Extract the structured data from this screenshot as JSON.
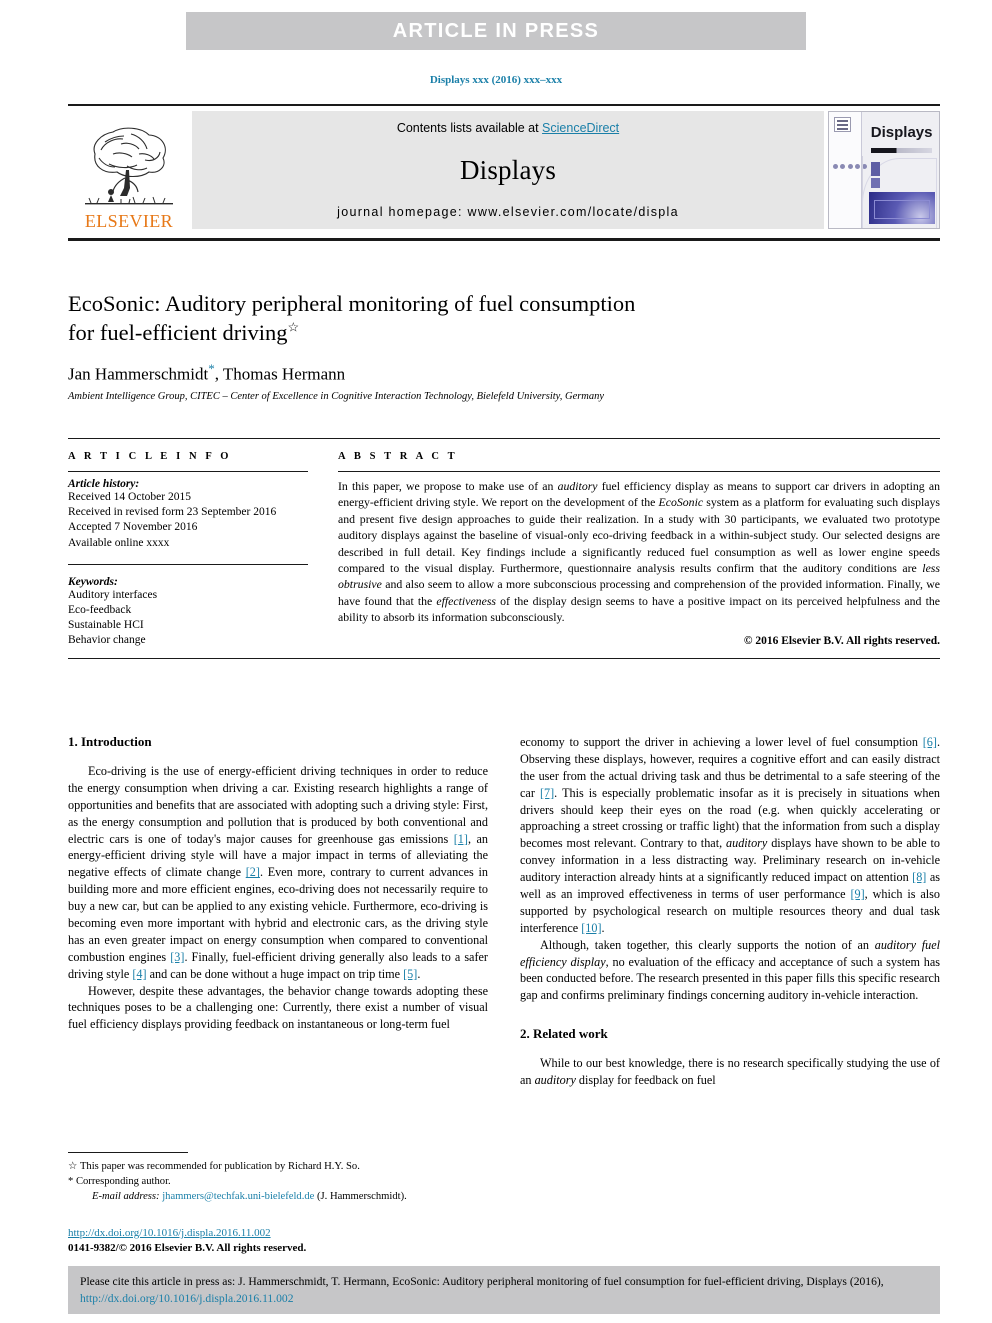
{
  "banner": {
    "label": "ARTICLE  IN  PRESS"
  },
  "volume_line": "Displays xxx (2016) xxx–xxx",
  "masthead": {
    "contents_prefix": "Contents lists available at ",
    "sciencedirect": "ScienceDirect",
    "journal_title": "Displays",
    "homepage": "journal homepage: www.elsevier.com/locate/displa",
    "publisher_word": "ELSEVIER",
    "cover_title": "Displays"
  },
  "article": {
    "title_line1": "EcoSonic: Auditory peripheral monitoring of fuel consumption",
    "title_line2": "for fuel-efficient driving",
    "title_star": "☆",
    "authors_a": "Jan Hammerschmidt",
    "authors_star": "*",
    "authors_b": ", Thomas Hermann",
    "affiliation": "Ambient Intelligence Group, CITEC – Center of Excellence in Cognitive Interaction Technology, Bielefeld University, Germany"
  },
  "info": {
    "heading": "A R T I C L E   I N F O",
    "history_label": "Article history:",
    "history": [
      "Received 14 October 2015",
      "Received in revised form 23 September 2016",
      "Accepted 7 November 2016",
      "Available online xxxx"
    ],
    "keywords_label": "Keywords:",
    "keywords": [
      "Auditory interfaces",
      "Eco-feedback",
      "Sustainable HCI",
      "Behavior change"
    ]
  },
  "abstract": {
    "heading": "A B S T R A C T",
    "p1_a": "In this paper, we propose to make use of an ",
    "p1_i1": "auditory",
    "p1_b": " fuel efficiency display as means to support car drivers in adopting an energy-efficient driving style. We report on the development of the ",
    "p1_i2": "EcoSonic",
    "p1_c": " system as a platform for evaluating such displays and present five design approaches to guide their realization. In a study with 30 participants, we evaluated two prototype auditory displays against the baseline of visual-only eco-driving feedback in a within-subject study. Our selected designs are described in full detail. Key findings include a significantly reduced fuel consumption as well as lower engine speeds compared to the visual display. Furthermore, questionnaire analysis results confirm that the auditory conditions are ",
    "p1_i3": "less obtrusive",
    "p1_d": " and also seem to allow a more subconscious processing and comprehension of the provided information. Finally, we have found that the ",
    "p1_i4": "effectiveness",
    "p1_e": " of the display design seems to have a positive impact on its perceived helpfulness and the ability to absorb its information subconsciously.",
    "copyright": "© 2016 Elsevier B.V. All rights reserved."
  },
  "body": {
    "sec1_heading": "1. Introduction",
    "sec1_p1_a": "Eco-driving is the use of energy-efficient driving techniques in order to reduce the energy consumption when driving a car. Existing research highlights a range of opportunities and benefits that are associated with adopting such a driving style: First, as the energy consumption and pollution that is produced by both conventional and electric cars is one of today's major causes for greenhouse gas emissions ",
    "sec1_p1_r1": "[1]",
    "sec1_p1_b": ", an energy-efficient driving style will have a major impact in terms of alleviating the negative effects of climate change ",
    "sec1_p1_r2": "[2]",
    "sec1_p1_c": ". Even more, contrary to current advances in building more and more efficient engines, eco-driving does not necessarily require to buy a new car, but can be applied to any existing vehicle. Furthermore, eco-driving is becoming even more important with hybrid and electronic cars, as the driving style has an even greater impact on energy consumption when compared to conventional combustion engines ",
    "sec1_p1_r3": "[3]",
    "sec1_p1_d": ". Finally, fuel-efficient driving generally also leads to a safer driving style ",
    "sec1_p1_r4": "[4]",
    "sec1_p1_e": " and can be done without a huge impact on trip time ",
    "sec1_p1_r5": "[5]",
    "sec1_p1_f": ".",
    "sec1_p2": "However, despite these advantages, the behavior change towards adopting these techniques poses to be a challenging one: Currently, there exist a number of visual fuel efficiency displays providing feedback on instantaneous or long-term fuel",
    "rcol_p1_a": "economy to support the driver in achieving a lower level of fuel consumption ",
    "rcol_p1_r6": "[6]",
    "rcol_p1_b": ". Observing these displays, however, requires a cognitive effort and can easily distract the user from the actual driving task and thus be detrimental to a safe steering of the car ",
    "rcol_p1_r7": "[7]",
    "rcol_p1_c": ". This is especially problematic insofar as it is precisely in situations when drivers should keep their eyes on the road (e.g. when quickly accelerating or approaching a street crossing or traffic light) that the information from such a display becomes most relevant. Contrary to that, ",
    "rcol_p1_i1": "auditory",
    "rcol_p1_d": " displays have shown to be able to convey information in a less distracting way. Preliminary research on in-vehicle auditory interaction already hints at a significantly reduced impact on attention ",
    "rcol_p1_r8": "[8]",
    "rcol_p1_e": " as well as an improved effectiveness in terms of user performance ",
    "rcol_p1_r9": "[9]",
    "rcol_p1_f": ", which is also supported by psychological research on multiple resources theory and dual task interference ",
    "rcol_p1_r10": "[10]",
    "rcol_p1_g": ".",
    "rcol_p2_a": "Although, taken together, this clearly supports the notion of an ",
    "rcol_p2_i1": "auditory fuel efficiency display",
    "rcol_p2_b": ", no evaluation of the efficacy and acceptance of such a system has been conducted before. The research presented in this paper fills this specific research gap and confirms preliminary findings concerning auditory in-vehicle interaction.",
    "sec2_heading": "2. Related work",
    "sec2_p1_a": "While to our best knowledge, there is no research specifically studying the use of an ",
    "sec2_p1_i1": "auditory",
    "sec2_p1_b": " display for feedback on fuel"
  },
  "footnotes": {
    "fn1_mark": "☆",
    "fn1_text": " This paper was recommended for publication by Richard H.Y. So.",
    "fn2_mark": "*",
    "fn2_text": " Corresponding author.",
    "email_label": "E-mail address:",
    "email": "jhammers@techfak.uni-bielefeld.de",
    "email_suffix": " (J. Hammerschmidt).",
    "doi": "http://dx.doi.org/10.1016/j.displa.2016.11.002",
    "issn": "0141-9382/© 2016 Elsevier B.V. All rights reserved."
  },
  "cite_bar": {
    "text_a": "Please cite this article in press as: J. Hammerschmidt, T. Hermann, EcoSonic: Auditory peripheral monitoring of fuel consumption for fuel-efficient driving, Displays (2016), ",
    "link": "http://dx.doi.org/10.1016/j.displa.2016.11.002"
  },
  "colors": {
    "accent_link": "#1a7fa8",
    "banner_bg": "#c6c6c8",
    "elsevier_orange": "#e77817",
    "masthead_bg": "#e6e6e6"
  }
}
